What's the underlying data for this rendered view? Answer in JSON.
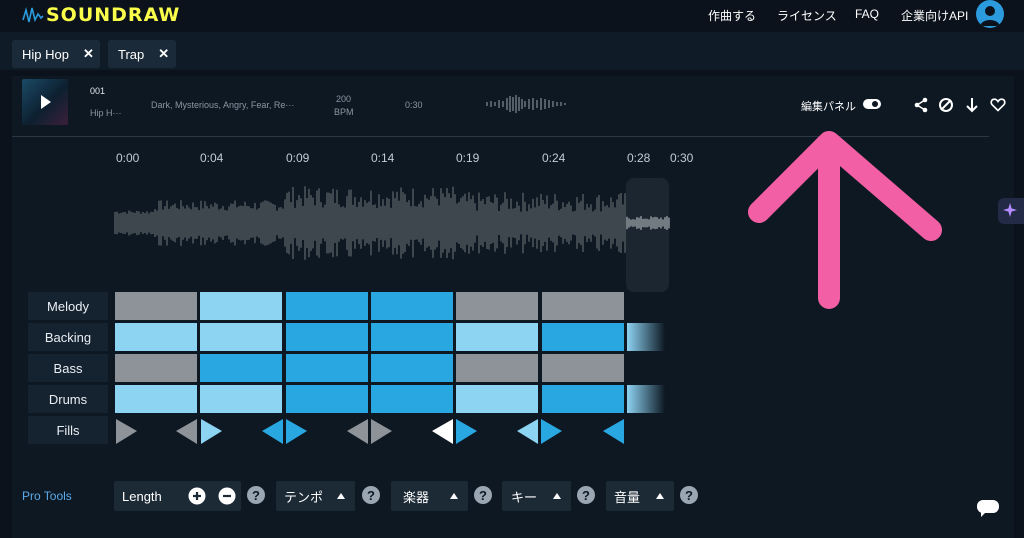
{
  "header": {
    "logo_text": "SOUNDRAW",
    "nav": [
      "作曲する",
      "ライセンス",
      "FAQ",
      "企業向けAPI"
    ]
  },
  "tags": [
    {
      "label": "Hip Hop",
      "close": "✕"
    },
    {
      "label": "Trap",
      "close": "✕"
    }
  ],
  "song": {
    "number": "001",
    "genre": "Hip H···",
    "moods": "Dark, Mysterious, Angry, Fear, Re···",
    "bpm_value": "200",
    "bpm_unit": "BPM",
    "duration": "0:30",
    "edit_panel_label": "編集パネル"
  },
  "timeline": [
    "0:00",
    "0:04",
    "0:09",
    "0:14",
    "0:19",
    "0:24",
    "0:28",
    "0:30"
  ],
  "tracks": [
    {
      "name": "Melody",
      "levels": [
        "gray",
        "light",
        "mid",
        "mid",
        "gray",
        "gray"
      ]
    },
    {
      "name": "Backing",
      "levels": [
        "light",
        "light",
        "mid",
        "mid",
        "light",
        "mid"
      ]
    },
    {
      "name": "Bass",
      "levels": [
        "gray",
        "mid",
        "mid",
        "mid",
        "gray",
        "gray"
      ]
    },
    {
      "name": "Drums",
      "levels": [
        "light",
        "light",
        "mid",
        "mid",
        "light",
        "mid"
      ]
    },
    {
      "name": "Fills",
      "levels": []
    }
  ],
  "tools": {
    "pro_tools_label": "Pro Tools",
    "length_label": "Length",
    "tempo_label": "テンポ",
    "instrument_label": "楽器",
    "key_label": "キー",
    "volume_label": "音量",
    "help_glyph": "?"
  },
  "colors": {
    "logo": "#fbfd4b",
    "cell_gray": "#8e9399",
    "cell_light": "#8dd3f2",
    "cell_mid": "#29a7e1",
    "arrow_annotation": "#f35fa4",
    "pro_tools": "#5aa9e6"
  }
}
